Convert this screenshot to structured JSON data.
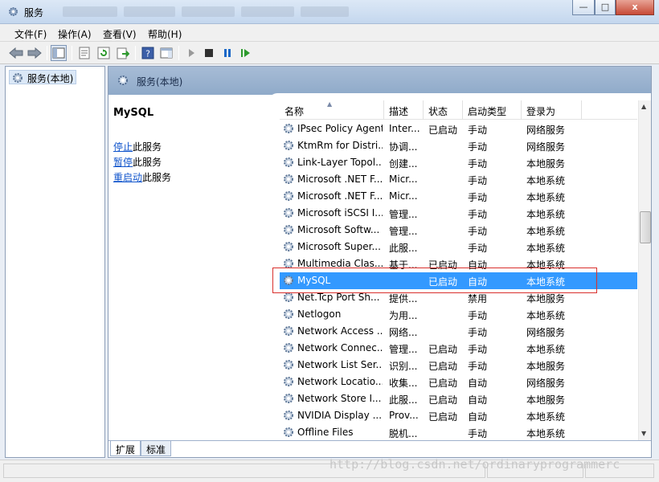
{
  "window": {
    "title": "服务",
    "accent": "#3399ff",
    "highlight_color": "#d9302d"
  },
  "window_controls": {
    "minimize": "—",
    "maximize": "□",
    "close": "x"
  },
  "menu": [
    {
      "label": "文件(F)"
    },
    {
      "label": "操作(A)"
    },
    {
      "label": "查看(V)"
    },
    {
      "label": "帮助(H)"
    }
  ],
  "toolbar": {
    "icons": [
      "back-arrow-icon",
      "forward-arrow-icon",
      "show-hide-tree-icon",
      "properties-icon",
      "refresh-icon",
      "export-list-icon",
      "help-icon",
      "show-action-pane-icon",
      "start-service-icon",
      "stop-service-icon",
      "pause-service-icon",
      "resume-service-icon"
    ]
  },
  "tree": {
    "root_label": "服务(本地)"
  },
  "main": {
    "header_title": "服务(本地)",
    "selected_service": "MySQL",
    "actions": [
      {
        "link": "停止",
        "suffix": "此服务"
      },
      {
        "link": "暂停",
        "suffix": "此服务"
      },
      {
        "link": "重启动",
        "suffix": "此服务"
      }
    ]
  },
  "list": {
    "columns": [
      "名称",
      "描述",
      "状态",
      "启动类型",
      "登录为"
    ],
    "rows": [
      {
        "name": "IPsec Policy Agent",
        "desc": "Inter...",
        "status": "已启动",
        "startup": "手动",
        "logon": "网络服务",
        "selected": false
      },
      {
        "name": "KtmRm for Distri...",
        "desc": "协调...",
        "status": "",
        "startup": "手动",
        "logon": "网络服务",
        "selected": false
      },
      {
        "name": "Link-Layer Topol...",
        "desc": "创建...",
        "status": "",
        "startup": "手动",
        "logon": "本地服务",
        "selected": false
      },
      {
        "name": "Microsoft .NET F...",
        "desc": "Micr...",
        "status": "",
        "startup": "手动",
        "logon": "本地系统",
        "selected": false
      },
      {
        "name": "Microsoft .NET F...",
        "desc": "Micr...",
        "status": "",
        "startup": "手动",
        "logon": "本地系统",
        "selected": false
      },
      {
        "name": "Microsoft iSCSI I...",
        "desc": "管理...",
        "status": "",
        "startup": "手动",
        "logon": "本地系统",
        "selected": false
      },
      {
        "name": "Microsoft Softw...",
        "desc": "管理...",
        "status": "",
        "startup": "手动",
        "logon": "本地系统",
        "selected": false
      },
      {
        "name": "Microsoft Super...",
        "desc": "此服...",
        "status": "",
        "startup": "手动",
        "logon": "本地系统",
        "selected": false
      },
      {
        "name": "Multimedia Clas...",
        "desc": "基于...",
        "status": "已启动",
        "startup": "自动",
        "logon": "本地系统",
        "selected": false
      },
      {
        "name": "MySQL",
        "desc": "",
        "status": "已启动",
        "startup": "自动",
        "logon": "本地系统",
        "selected": true
      },
      {
        "name": "Net.Tcp Port Sh...",
        "desc": "提供...",
        "status": "",
        "startup": "禁用",
        "logon": "本地服务",
        "selected": false
      },
      {
        "name": "Netlogon",
        "desc": "为用...",
        "status": "",
        "startup": "手动",
        "logon": "本地系统",
        "selected": false
      },
      {
        "name": "Network Access ...",
        "desc": "网络...",
        "status": "",
        "startup": "手动",
        "logon": "网络服务",
        "selected": false
      },
      {
        "name": "Network Connec...",
        "desc": "管理...",
        "status": "已启动",
        "startup": "手动",
        "logon": "本地系统",
        "selected": false
      },
      {
        "name": "Network List Ser...",
        "desc": "识别...",
        "status": "已启动",
        "startup": "手动",
        "logon": "本地服务",
        "selected": false
      },
      {
        "name": "Network Locatio...",
        "desc": "收集...",
        "status": "已启动",
        "startup": "自动",
        "logon": "网络服务",
        "selected": false
      },
      {
        "name": "Network Store I...",
        "desc": "此服...",
        "status": "已启动",
        "startup": "自动",
        "logon": "本地服务",
        "selected": false
      },
      {
        "name": "NVIDIA Display ...",
        "desc": "Prov...",
        "status": "已启动",
        "startup": "自动",
        "logon": "本地系统",
        "selected": false
      },
      {
        "name": "Offline Files",
        "desc": "脱机...",
        "status": "",
        "startup": "手动",
        "logon": "本地系统",
        "selected": false
      }
    ]
  },
  "tabs": [
    {
      "label": "扩展",
      "active": true
    },
    {
      "label": "标准",
      "active": false
    }
  ],
  "watermark": "http://blog.csdn.net/ordinaryprogrammerc"
}
